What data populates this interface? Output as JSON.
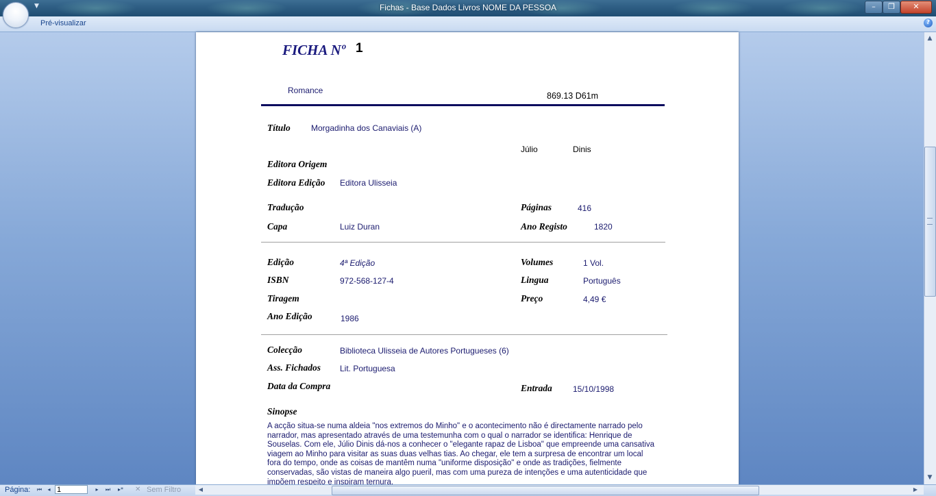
{
  "window": {
    "title": "Fichas  -  Base Dados Livros NOME DA PESSOA",
    "minimize_glyph": "–",
    "maximize_glyph": "❐",
    "close_glyph": "✕"
  },
  "ribbon": {
    "tab_label": "Pré-visualizar",
    "help_glyph": "?"
  },
  "record": {
    "ficha_label": "FICHA Nº",
    "ficha_number": "1",
    "genre": "Romance",
    "cota": "869.13 D61m",
    "titulo_label": "Título",
    "titulo": "Morgadinha dos Canaviais (A)",
    "author_first": "Júlio",
    "author_last": "Dinis",
    "editora_origem_label": "Editora Origem",
    "editora_edicao_label": "Editora Edição",
    "editora_edicao": "Editora Ulisseia",
    "traducao_label": "Tradução",
    "paginas_label": "Páginas",
    "paginas": "416",
    "capa_label": "Capa",
    "capa": "Luiz Duran",
    "ano_registo_label": "Ano Registo",
    "ano_registo": "1820",
    "edicao_label": "Edição",
    "edicao": "4ª Edição",
    "volumes_label": "Volumes",
    "volumes": "1 Vol.",
    "isbn_label": "ISBN",
    "isbn": "972-568-127-4",
    "lingua_label": "Lingua",
    "lingua": "Português",
    "tiragem_label": "Tiragem",
    "preco_label": "Preço",
    "preco": "4,49 €",
    "ano_edicao_label": "Ano Edição",
    "ano_edicao": "1986",
    "coleccao_label": "Colecção",
    "coleccao": "Biblioteca Ulisseia de Autores Portugueses (6)",
    "ass_fichados_label": "Ass. Fichados",
    "ass_fichados": "Lit. Portuguesa",
    "data_compra_label": "Data da Compra",
    "entrada_label": "Entrada",
    "entrada": "15/10/1998",
    "sinopse_label": "Sinopse",
    "sinopse": "A acção situa-se numa aldeia \"nos extremos do Minho\" e o acontecimento não é directamente narrado pelo narrador, mas apresentado através de uma testemunha com o qual o narrador se identifica: Henrique de Souselas. Com ele, Júlio Dinis dá-nos a conhecer o \"elegante rapaz de Lisboa\" que empreende uma cansativa viagem ao Minho para visitar as suas duas velhas tias. Ao chegar, ele tem a surpresa de encontrar um local fora do tempo, onde as coisas de mantêm numa \"uniforme disposição\" e onde as tradições, fielmente conservadas, são vistas de maneira algo pueril, mas com uma pureza de intenções e uma autenticidade que impõem respeito e inspiram ternura."
  },
  "statusbar": {
    "page_label": "Página:",
    "page_value": "1",
    "filter_label": "Sem Filtro",
    "nav_first": "⏮",
    "nav_prev": "◂",
    "nav_next": "▸",
    "nav_last": "⏭",
    "nav_new": "▸*"
  },
  "colors": {
    "title_navy": "#1a1a7e",
    "value_navy": "#1a1a6e",
    "rule_navy": "#0a0a5e",
    "ribbon_text": "#15428b"
  }
}
